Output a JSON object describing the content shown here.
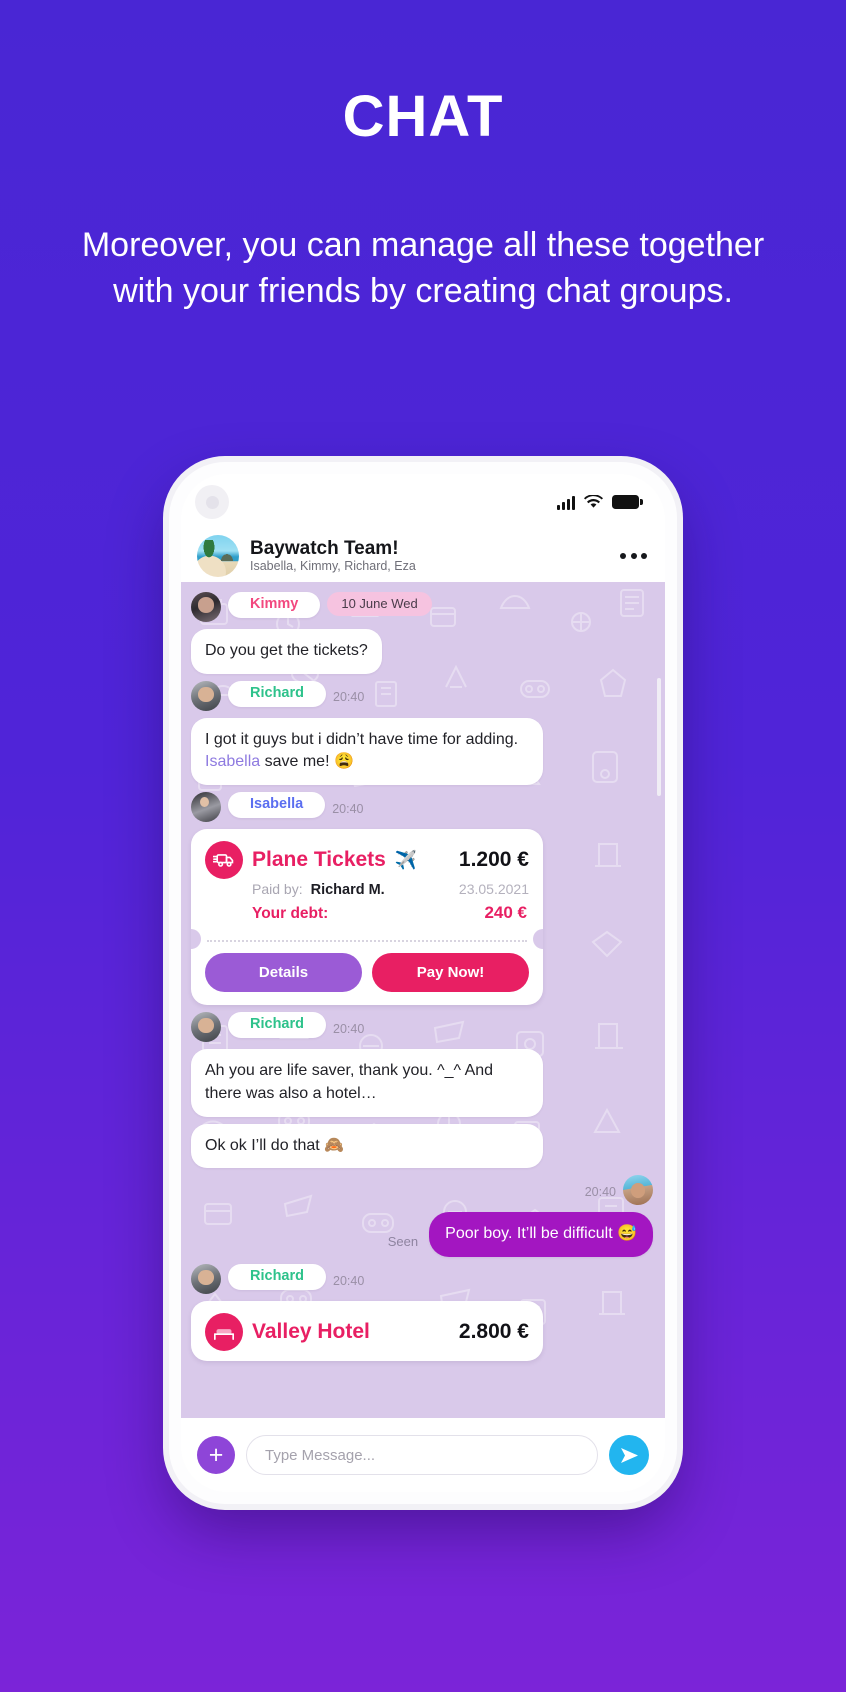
{
  "promo": {
    "title": "CHAT",
    "subtitle": "Moreover, you can manage all these together with your friends by creating chat groups."
  },
  "statusbar": {
    "signal_icon": "cellular-signal-icon",
    "wifi_icon": "wifi-icon",
    "battery_icon": "battery-full-icon"
  },
  "chat_header": {
    "avatar_icon": "group-avatar",
    "title": "Baywatch Team!",
    "members": "Isabella, Kimmy, Richard, Eza",
    "menu_icon": "more-options-icon"
  },
  "messages": [
    {
      "id": "m1",
      "type": "text",
      "sender": "Kimmy",
      "sender_color": "#f2487f",
      "date_badge": "10 June Wed",
      "text": "Do you get the tickets?"
    },
    {
      "id": "m2",
      "type": "text",
      "sender": "Richard",
      "sender_color": "#2ec28b",
      "time": "20:40",
      "text_part1": "I got it guys but i didn’t have time for adding. ",
      "mention": "Isabella",
      "text_part2": " save me! 😩"
    },
    {
      "id": "m3",
      "type": "expense",
      "sender": "Isabella",
      "sender_color": "#5b6ef0",
      "time": "20:40",
      "icon": "truck-icon",
      "title": "Plane Tickets",
      "title_emoji": "✈️",
      "amount": "1.200 €",
      "paid_by_label": "Paid by:",
      "paid_by_value": "Richard M.",
      "date": "23.05.2021",
      "debt_label": "Your debt:",
      "debt_value": "240 €",
      "details_button": "Details",
      "pay_button": "Pay Now!"
    },
    {
      "id": "m4",
      "type": "text",
      "sender": "Richard",
      "sender_color": "#2ec28b",
      "time": "20:40",
      "text": "Ah you are life saver, thank you. ^_^ And there was also a hotel…"
    },
    {
      "id": "m5",
      "type": "text",
      "sender": null,
      "text": "Ok ok I’ll do that 🙈"
    },
    {
      "id": "m6",
      "type": "outgoing",
      "time": "20:40",
      "status": "Seen",
      "text": "Poor boy. It’ll be difficult 😅"
    },
    {
      "id": "m7",
      "type": "expense",
      "sender": "Richard",
      "sender_color": "#2ec28b",
      "time": "20:40",
      "icon": "bed-icon",
      "title": "Valley Hotel",
      "amount": "2.800 €"
    }
  ],
  "composer": {
    "add_icon": "plus-icon",
    "add_label": "+",
    "placeholder": "Type Message...",
    "value": "",
    "send_icon": "send-icon"
  },
  "colors": {
    "background_top": "#4926d4",
    "background_bottom": "#7b24d8",
    "chat_background": "#d9c9ea",
    "accent_pink": "#e81f63",
    "accent_purple": "#9b5bd6",
    "outgoing_bubble": "#a316c1",
    "send_blue": "#22b5ef",
    "name_kimmy": "#f2487f",
    "name_richard": "#2ec28b",
    "name_isabella": "#5b6ef0"
  }
}
